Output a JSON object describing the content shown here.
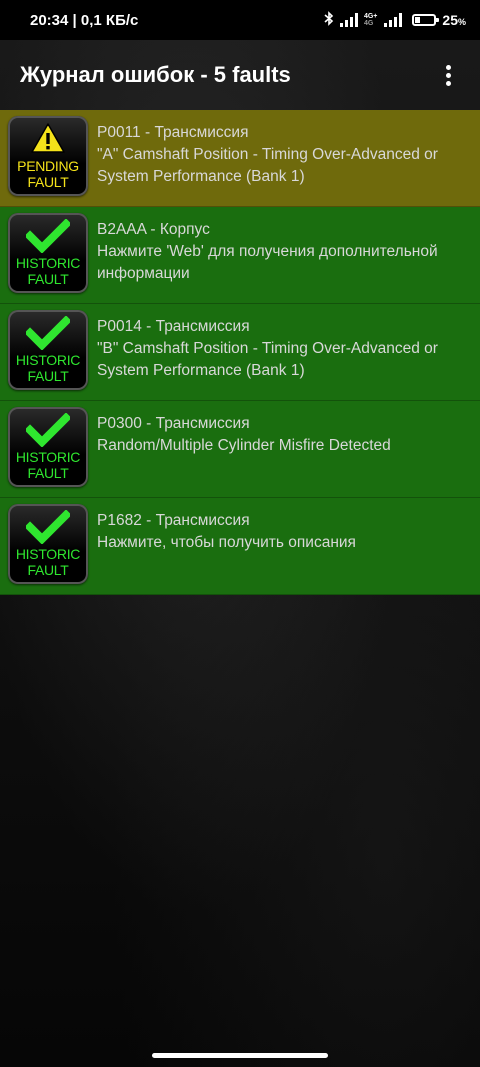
{
  "status_bar": {
    "time_data": "20:34 | 0,1 КБ/с",
    "net_tag_top": "4G+",
    "net_tag_bottom": "4G",
    "battery_pct": "25",
    "battery_unit": "%",
    "bluetooth_icon": "bluetooth-icon",
    "battery_level_percent": 25
  },
  "app_bar": {
    "title": "Журнал ошибок - 5 faults",
    "menu_icon": "overflow-menu-icon"
  },
  "faults": [
    {
      "status": "pending",
      "badge_line1": "PENDING",
      "badge_line2": "FAULT",
      "badge_icon": "warning-triangle-icon",
      "code": "P0011 - Трансмиссия",
      "description": "\"A\" Camshaft Position - Timing Over-Advanced or System Performance (Bank 1)",
      "color": "#6f6a0c"
    },
    {
      "status": "historic",
      "badge_line1": "HISTORIC",
      "badge_line2": "FAULT",
      "badge_icon": "checkmark-icon",
      "code": "B2AAA - Корпус",
      "description": "Нажмите 'Web' для получения дополнительной информации",
      "color": "#1a6e0f"
    },
    {
      "status": "historic",
      "badge_line1": "HISTORIC",
      "badge_line2": "FAULT",
      "badge_icon": "checkmark-icon",
      "code": "P0014 - Трансмиссия",
      "description": "\"B\" Camshaft Position - Timing Over-Advanced or System Performance (Bank 1)",
      "color": "#1a6e0f"
    },
    {
      "status": "historic",
      "badge_line1": "HISTORIC",
      "badge_line2": "FAULT",
      "badge_icon": "checkmark-icon",
      "code": "P0300 - Трансмиссия",
      "description": "Random/Multiple Cylinder Misfire Detected",
      "color": "#1a6e0f"
    },
    {
      "status": "historic",
      "badge_line1": "HISTORIC",
      "badge_line2": "FAULT",
      "badge_icon": "checkmark-icon",
      "code": "P1682 - Трансмиссия",
      "description": "Нажмите, чтобы получить описания",
      "color": "#1a6e0f"
    }
  ]
}
